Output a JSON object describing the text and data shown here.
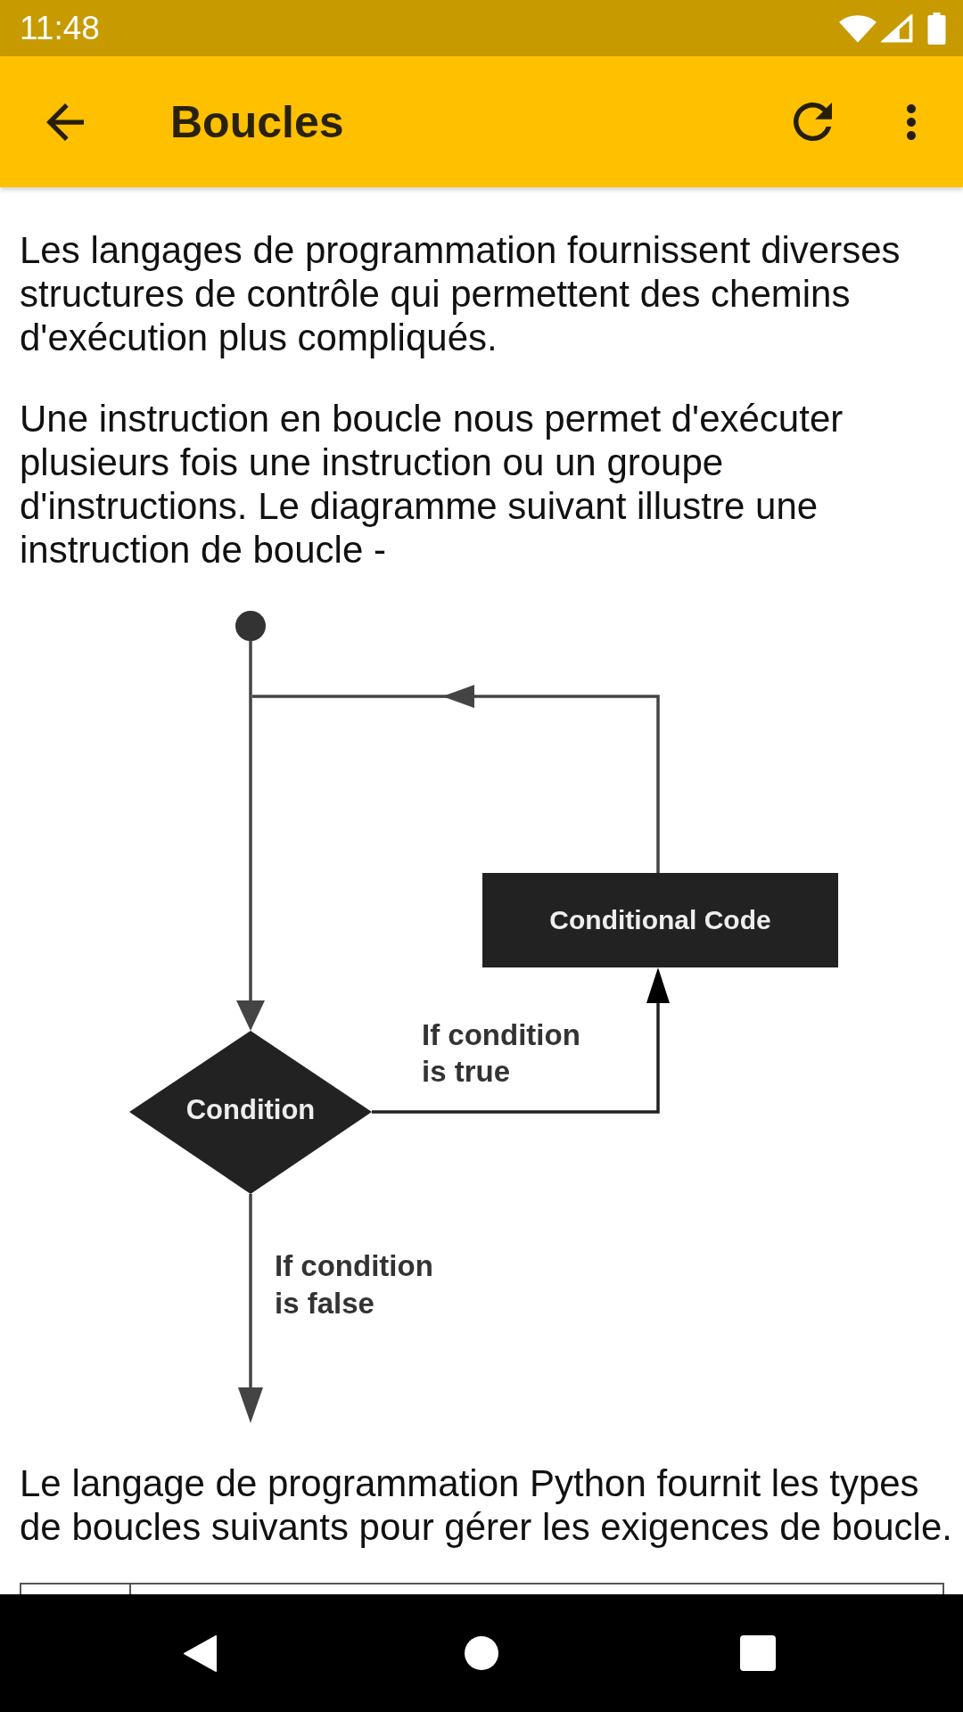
{
  "status_bar": {
    "time": "11:48"
  },
  "app_bar": {
    "title": "Boucles"
  },
  "article": {
    "paragraphs_before": [
      "Les langages de programmation fournissent diverses structures de contrôle qui permettent des chemins d'exécution plus compliqués.",
      "Une instruction en boucle nous permet d'exécuter plusieurs fois une instruction ou un groupe d'instructions. Le diagramme suivant illustre une instruction de boucle -"
    ],
    "diagram": {
      "process_label": "Conditional Code",
      "decision_label": "Condition",
      "true_label": {
        "lines": [
          "If condition",
          "is true"
        ]
      },
      "false_label": {
        "lines": [
          "If condition",
          "is false"
        ]
      }
    },
    "paragraphs_after": [
      "Le langage de programmation Python fournit les types de boucles suivants pour gérer les exigences de boucle."
    ]
  }
}
